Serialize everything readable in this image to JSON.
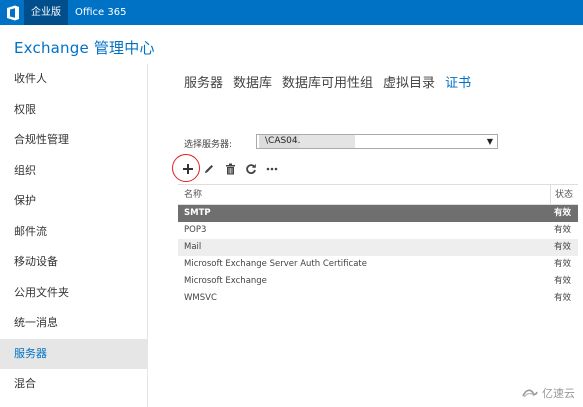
{
  "topbar": {
    "logo_icon": "office-logo-icon",
    "tabs": [
      {
        "label": "企业版",
        "active": true
      },
      {
        "label": "Office 365",
        "active": false
      }
    ]
  },
  "app": {
    "title": "Exchange 管理中心"
  },
  "leftnav": {
    "items": [
      {
        "label": "收件人"
      },
      {
        "label": "权限"
      },
      {
        "label": "合规性管理"
      },
      {
        "label": "组织"
      },
      {
        "label": "保护"
      },
      {
        "label": "邮件流"
      },
      {
        "label": "移动设备"
      },
      {
        "label": "公用文件夹"
      },
      {
        "label": "统一消息"
      },
      {
        "label": "服务器",
        "selected": true
      },
      {
        "label": "混合"
      }
    ]
  },
  "tabs": [
    {
      "label": "服务器"
    },
    {
      "label": "数据库"
    },
    {
      "label": "数据库可用性组"
    },
    {
      "label": "虚拟目录"
    },
    {
      "label": "证书",
      "active": true
    }
  ],
  "server_select": {
    "label": "选择服务器:",
    "value": "\\CAS04."
  },
  "toolbar": {
    "icons": [
      "add-icon",
      "edit-icon",
      "delete-icon",
      "refresh-icon",
      "more-icon"
    ]
  },
  "grid": {
    "headers": {
      "name": "名称",
      "status": "状态"
    },
    "rows": [
      {
        "name": "SMTP",
        "status": "有效"
      },
      {
        "name": "POP3",
        "status": "有效"
      },
      {
        "name": "Mail",
        "status": "有效"
      },
      {
        "name": "Microsoft Exchange Server Auth Certificate",
        "status": "有效"
      },
      {
        "name": "Microsoft Exchange",
        "status": "有效"
      },
      {
        "name": "WMSVC",
        "status": "有效"
      }
    ]
  },
  "watermark": {
    "text": "亿速云"
  },
  "colors": {
    "accent": "#0072c6",
    "topbar_active": "#004e8c",
    "selected_row": "#6f6f6f",
    "highlight_circle": "#e02020"
  }
}
